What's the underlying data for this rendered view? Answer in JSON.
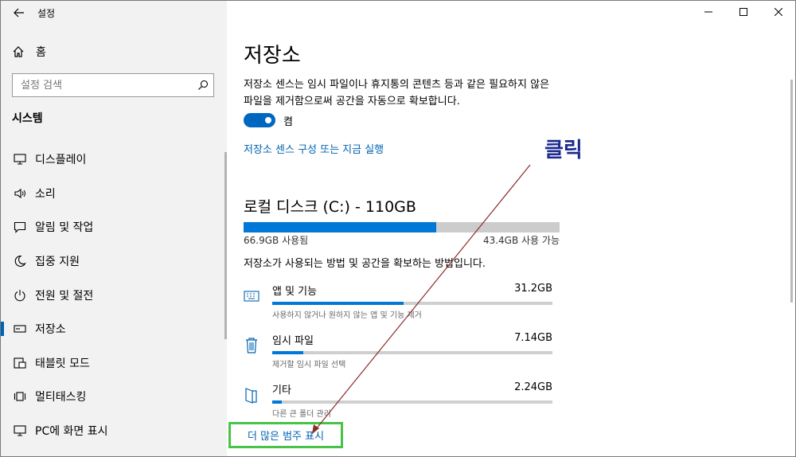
{
  "window": {
    "title": "설정"
  },
  "sidebar": {
    "home": "홈",
    "search_placeholder": "설정 검색",
    "section": "시스템",
    "items": [
      {
        "label": "디스플레이",
        "icon": "monitor-icon"
      },
      {
        "label": "소리",
        "icon": "speaker-icon"
      },
      {
        "label": "알림 및 작업",
        "icon": "message-icon"
      },
      {
        "label": "집중 지원",
        "icon": "moon-icon"
      },
      {
        "label": "전원 및 절전",
        "icon": "power-icon"
      },
      {
        "label": "저장소",
        "icon": "storage-icon",
        "active": true
      },
      {
        "label": "태블릿 모드",
        "icon": "tablet-icon"
      },
      {
        "label": "멀티태스킹",
        "icon": "multitask-icon"
      },
      {
        "label": "PC에 화면 표시",
        "icon": "project-icon"
      }
    ]
  },
  "main": {
    "title": "저장소",
    "description": "저장소 센스는 임시 파일이나 휴지통의 콘텐츠 등과 같은 필요하지 않은 파일을 제거함으로써 공간을 자동으로 확보합니다.",
    "toggle_state": "켬",
    "configure_link": "저장소 센스 구성 또는 지금 실행",
    "disk": {
      "title": "로컬 디스크 (C:) - 110GB",
      "used_label": "66.9GB 사용됨",
      "free_label": "43.4GB 사용 가능",
      "used_fraction": 0.61
    },
    "how_text": "저장소가 사용되는 방법 및 공간을 확보하는 방법입니다.",
    "categories": [
      {
        "name": "앱 및 기능",
        "size": "31.2GB",
        "hint": "사용하지 않거나 원하지 않는 앱 및 기능 제거",
        "fraction": 0.47,
        "icon": "keyboard-icon"
      },
      {
        "name": "임시 파일",
        "size": "7.14GB",
        "hint": "제거할 임시 파일 선택",
        "fraction": 0.11,
        "icon": "trash-icon"
      },
      {
        "name": "기타",
        "size": "2.24GB",
        "hint": "다른 큰 폴더 관리",
        "fraction": 0.035,
        "icon": "folder-icon"
      }
    ],
    "more_link": "더 많은 범주 표시"
  },
  "annotation": {
    "text": "클릭",
    "color": "#1d2b8f"
  },
  "colors": {
    "accent": "#0078d7",
    "highlight_box": "#47c447",
    "arrow": "#8b2b2b"
  }
}
